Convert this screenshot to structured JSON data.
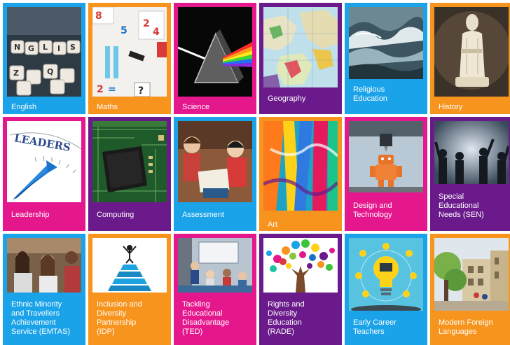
{
  "colors": {
    "blue": "#1aa3e8",
    "orange": "#f7941d",
    "magenta": "#e5178c",
    "purple": "#6a1a8a"
  },
  "tiles": [
    {
      "label": "English",
      "color": "blue",
      "icon": "letter-dice-image"
    },
    {
      "label": "Maths",
      "color": "orange",
      "icon": "number-blocks-image"
    },
    {
      "label": "Science",
      "color": "magenta",
      "icon": "prism-image"
    },
    {
      "label": "Geography",
      "color": "purple",
      "icon": "map-image"
    },
    {
      "label": "Religious\nEducation",
      "color": "blue",
      "icon": "waves-image"
    },
    {
      "label": "History",
      "color": "orange",
      "icon": "chess-statue-image"
    },
    {
      "label": "Leadership",
      "color": "magenta",
      "icon": "leadership-compass-image"
    },
    {
      "label": "Computing",
      "color": "purple",
      "icon": "circuit-board-image"
    },
    {
      "label": "Assessment",
      "color": "blue",
      "icon": "children-reading-image"
    },
    {
      "label": "Art",
      "color": "orange",
      "icon": "paint-strokes-image"
    },
    {
      "label": "Design and\nTechnology",
      "color": "magenta",
      "icon": "3d-printer-robot-image"
    },
    {
      "label": "Special\nEducational\nNeeds (SEN)",
      "color": "purple",
      "icon": "silhouettes-image"
    },
    {
      "label": "Ethnic Minority\nand Travellers\nAchievement\nService (EMTAS)",
      "color": "blue",
      "icon": "students-classroom-image"
    },
    {
      "label": "Inclusion and\nDiversity\nPartnership\n(IDP)",
      "color": "orange",
      "icon": "pyramid-figure-image"
    },
    {
      "label": "Tackling\nEducational\nDisadvantage\n(TED)",
      "color": "magenta",
      "icon": "classroom-image"
    },
    {
      "label": "Rights and\nDiversity\nEducation\n(RADE)",
      "color": "purple",
      "icon": "handprint-tree-image"
    },
    {
      "label": "Early Career\nTeachers",
      "color": "blue",
      "icon": "lightbulb-icons-image"
    },
    {
      "label": "Modern Foreign\nLanguages",
      "color": "orange",
      "icon": "european-street-image"
    }
  ]
}
